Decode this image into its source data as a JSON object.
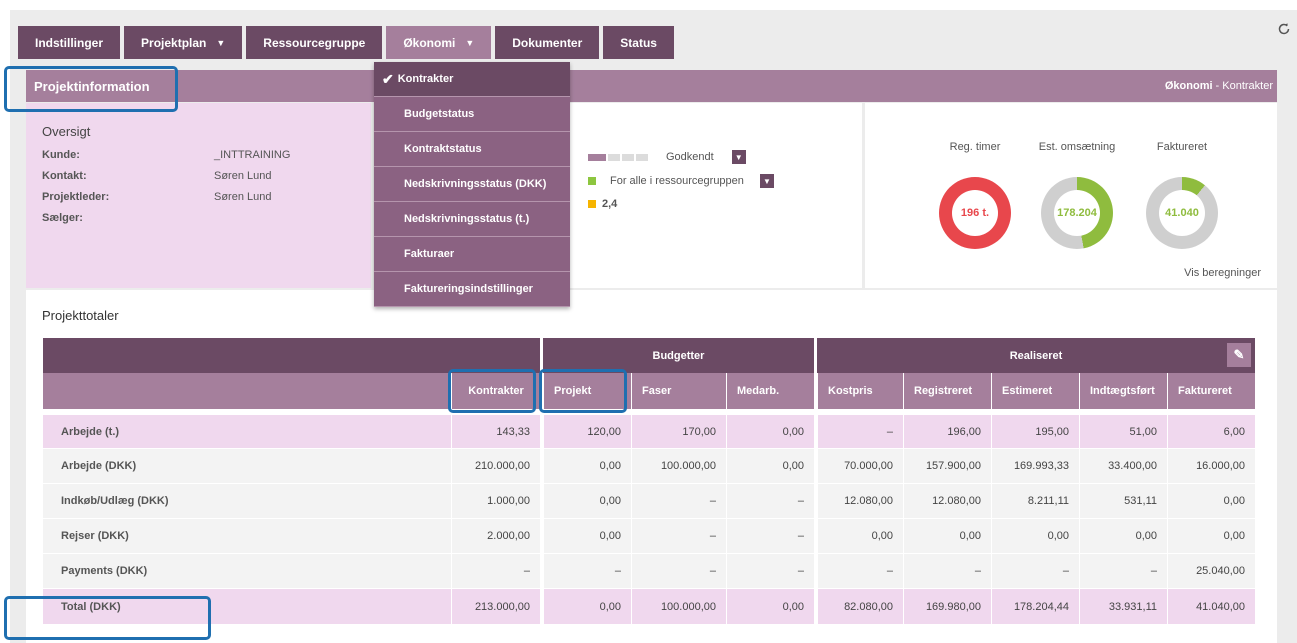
{
  "tabs": [
    {
      "label": "Indstillinger",
      "dropdown": false
    },
    {
      "label": "Projektplan",
      "dropdown": true
    },
    {
      "label": "Ressourcegruppe",
      "dropdown": false
    },
    {
      "label": "Økonomi",
      "dropdown": true,
      "active": true
    },
    {
      "label": "Dokumenter",
      "dropdown": false
    },
    {
      "label": "Status",
      "dropdown": false
    }
  ],
  "band": {
    "title": "Projektinformation",
    "context_bold": "Økonomi",
    "context_rest": "- Kontrakter"
  },
  "overview": {
    "title": "Oversigt",
    "rows": [
      {
        "label": "Kunde:",
        "value": "_INTTRAINING"
      },
      {
        "label": "Kontakt:",
        "value": "Søren Lund"
      },
      {
        "label": "Projektleder:",
        "value": "Søren Lund"
      },
      {
        "label": "Sælger:",
        "value": ""
      }
    ]
  },
  "status": {
    "approved_label": "Godkendt",
    "group_label": "For alle i ressourcegruppen",
    "value_label": "2,4",
    "colors": {
      "purple": "#a57f9c",
      "green": "#8dc63f",
      "yellow": "#f6b400"
    }
  },
  "kpis": [
    {
      "label": "Reg. timer",
      "value": "196 t.",
      "color": "#e8474c",
      "share": 1.0,
      "text_color": "#e8474c"
    },
    {
      "label": "Est. omsætning",
      "value": "178.204",
      "color": "#8fbc3e",
      "share": 0.47,
      "text_color": "#8fbc3e"
    },
    {
      "label": "Faktureret",
      "value": "41.040",
      "color": "#8fbc3e",
      "share": 0.11,
      "text_color": "#8fbc3e"
    }
  ],
  "vis_beregninger": "Vis beregninger",
  "menu": {
    "items": [
      "Kontrakter",
      "Budgetstatus",
      "Kontraktstatus",
      "Nedskrivningsstatus (DKK)",
      "Nedskrivningsstatus (t.)",
      "Fakturaer",
      "Faktureringsindstillinger"
    ],
    "selected": "Kontrakter"
  },
  "totals": {
    "title": "Projekttotaler",
    "group_budget": "Budgetter",
    "group_real": "Realiseret",
    "columns": [
      "Kontrakter",
      "Projekt",
      "Faser",
      "Medarb.",
      "Kostpris",
      "Registreret",
      "Estimeret",
      "Indtægtsført",
      "Faktureret"
    ],
    "rows": [
      {
        "label": "Arbejde (t.)",
        "values": [
          "143,33",
          "120,00",
          "170,00",
          "0,00",
          "–",
          "196,00",
          "195,00",
          "51,00",
          "6,00"
        ]
      },
      {
        "label": "Arbejde (DKK)",
        "values": [
          "210.000,00",
          "0,00",
          "100.000,00",
          "0,00",
          "70.000,00",
          "157.900,00",
          "169.993,33",
          "33.400,00",
          "16.000,00"
        ]
      },
      {
        "label": "Indkøb/Udlæg (DKK)",
        "values": [
          "1.000,00",
          "0,00",
          "–",
          "–",
          "12.080,00",
          "12.080,00",
          "8.211,11",
          "531,11",
          "0,00"
        ]
      },
      {
        "label": "Rejser (DKK)",
        "values": [
          "2.000,00",
          "0,00",
          "–",
          "–",
          "0,00",
          "0,00",
          "0,00",
          "0,00",
          "0,00"
        ]
      },
      {
        "label": "Payments (DKK)",
        "values": [
          "–",
          "–",
          "–",
          "–",
          "–",
          "–",
          "–",
          "–",
          "25.040,00"
        ]
      },
      {
        "label": "Total (DKK)",
        "values": [
          "213.000,00",
          "0,00",
          "100.000,00",
          "0,00",
          "82.080,00",
          "169.980,00",
          "178.204,44",
          "33.931,11",
          "41.040,00"
        ]
      }
    ]
  }
}
